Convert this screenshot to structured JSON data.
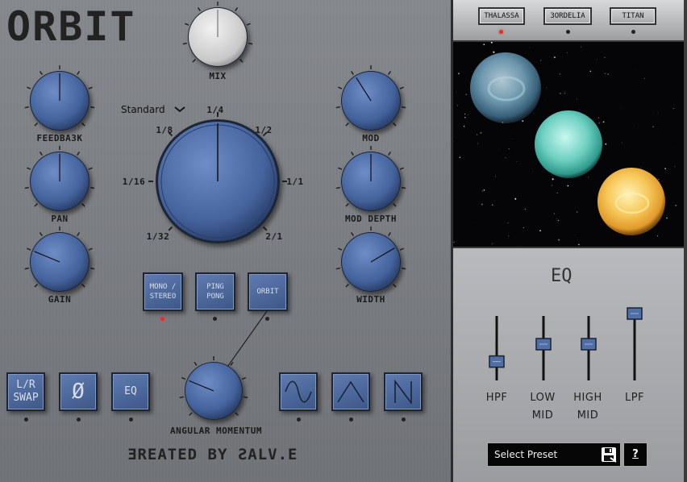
{
  "app": {
    "title": "ORBIT",
    "credit": "ƎREATED BY ƧALV.E"
  },
  "knobs": {
    "mix": {
      "label": "MIX",
      "value": 0.5
    },
    "feedback": {
      "label": "FEEDBA3K",
      "value": 0.5
    },
    "pan": {
      "label": "PAN",
      "value": 0.5
    },
    "gain": {
      "label": "GAIN",
      "value": 0.25
    },
    "mod": {
      "label": "MOD",
      "value": 0.38
    },
    "mod_depth": {
      "label": "MOD DEPTH",
      "value": 0.5
    },
    "width": {
      "label": "WIDTH",
      "value": 0.72
    },
    "angular_momentum": {
      "label": "ANGULAR MOMENTUM",
      "value": 0.25
    },
    "time": {
      "value": 0.5,
      "ticks": [
        "1/32",
        "1/16",
        "1/8",
        "1/4",
        "1/2",
        "1/1",
        "2/1"
      ]
    }
  },
  "time_mode": {
    "selected": "Standard"
  },
  "mode_buttons": [
    {
      "label": "MONO / STEREO",
      "active": true
    },
    {
      "label": "PING PONG",
      "active": false
    },
    {
      "label": "ORBIT",
      "active": false
    }
  ],
  "left_buttons": [
    {
      "label": "L/R SWAP",
      "icon": "lr-swap"
    },
    {
      "label": "Ø",
      "icon": "phase-invert-icon"
    },
    {
      "label": "EQ",
      "icon": "eq"
    }
  ],
  "wave_buttons": [
    {
      "icon": "sine-wave-icon"
    },
    {
      "icon": "triangle-wave-icon"
    },
    {
      "icon": "sawtooth-wave-icon"
    }
  ],
  "planet_tabs": [
    {
      "label": "THALASSA",
      "active": true
    },
    {
      "label": "3ORDELIA",
      "active": false
    },
    {
      "label": "TITAN",
      "active": false
    }
  ],
  "eq": {
    "title": "EQ",
    "sliders": [
      {
        "label_line1": "HPF",
        "label_line2": "",
        "value": 0.28
      },
      {
        "label_line1": "LOW",
        "label_line2": "MID",
        "value": 0.55
      },
      {
        "label_line1": "HIGH",
        "label_line2": "MID",
        "value": 0.55
      },
      {
        "label_line1": "LPF",
        "label_line2": "",
        "value": 1.0
      }
    ]
  },
  "preset": {
    "placeholder": "Select Preset",
    "help": "?"
  },
  "colors": {
    "knob": "#4a6aa8",
    "panel": "#adafb2",
    "led_active": "#e03030"
  }
}
